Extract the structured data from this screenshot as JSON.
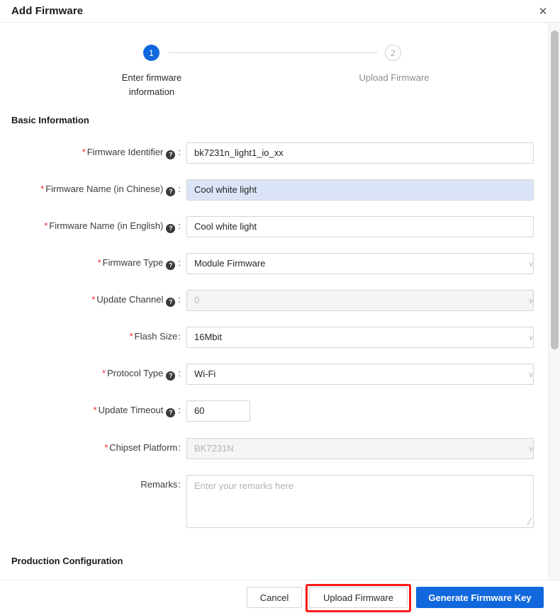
{
  "window": {
    "title": "Add Firmware",
    "close_icon": "close-icon",
    "close_glyph": "✕"
  },
  "steps": [
    {
      "number": "1",
      "label": "Enter firmware information",
      "state": "active"
    },
    {
      "number": "2",
      "label": "Upload Firmware",
      "state": "idle"
    }
  ],
  "sections": {
    "basic_information": "Basic Information",
    "production_configuration": "Production Configuration"
  },
  "icons": {
    "help": "?",
    "chevron_down": "∨",
    "required_asterisk": "*",
    "resize_handle": "╱"
  },
  "fields": {
    "firmware_identifier": {
      "label": "Firmware Identifier",
      "required": true,
      "has_help": true,
      "value": "bk7231n_light1_io_xx",
      "type": "text",
      "state": "normal"
    },
    "firmware_name_chinese": {
      "label": "Firmware Name (in Chinese)",
      "required": true,
      "has_help": true,
      "value": "Cool white light",
      "type": "text",
      "state": "selected"
    },
    "firmware_name_english": {
      "label": "Firmware Name (in English)",
      "required": true,
      "has_help": true,
      "value": "Cool white light",
      "type": "text",
      "state": "normal"
    },
    "firmware_type": {
      "label": "Firmware Type",
      "required": true,
      "has_help": true,
      "value": "Module Firmware",
      "type": "select",
      "state": "normal"
    },
    "update_channel": {
      "label": "Update Channel",
      "required": true,
      "has_help": true,
      "value": "0",
      "type": "select",
      "state": "disabled"
    },
    "flash_size": {
      "label": "Flash Size",
      "required": true,
      "has_help": false,
      "value": "16Mbit",
      "type": "select",
      "state": "normal"
    },
    "protocol_type": {
      "label": "Protocol Type",
      "required": true,
      "has_help": true,
      "value": "Wi-Fi",
      "type": "select",
      "state": "normal"
    },
    "update_timeout": {
      "label": "Update Timeout",
      "required": true,
      "has_help": true,
      "value": "60",
      "type": "text",
      "state": "normal"
    },
    "chipset_platform": {
      "label": "Chipset Platform",
      "required": true,
      "has_help": false,
      "value": "BK7231N",
      "type": "select",
      "state": "disabled"
    },
    "remarks": {
      "label": "Remarks",
      "required": false,
      "has_help": false,
      "value": "",
      "placeholder": "Enter your remarks here",
      "type": "textarea",
      "state": "normal"
    }
  },
  "footer": {
    "cancel": "Cancel",
    "upload": "Upload Firmware",
    "generate": "Generate Firmware Key"
  },
  "colors": {
    "accent_blue": "#1168dd",
    "required_red": "#f5222d",
    "highlight_red": "#ff1a1a",
    "selection_blue": "#dbe4f7",
    "disabled_gray": "#f5f5f5"
  }
}
